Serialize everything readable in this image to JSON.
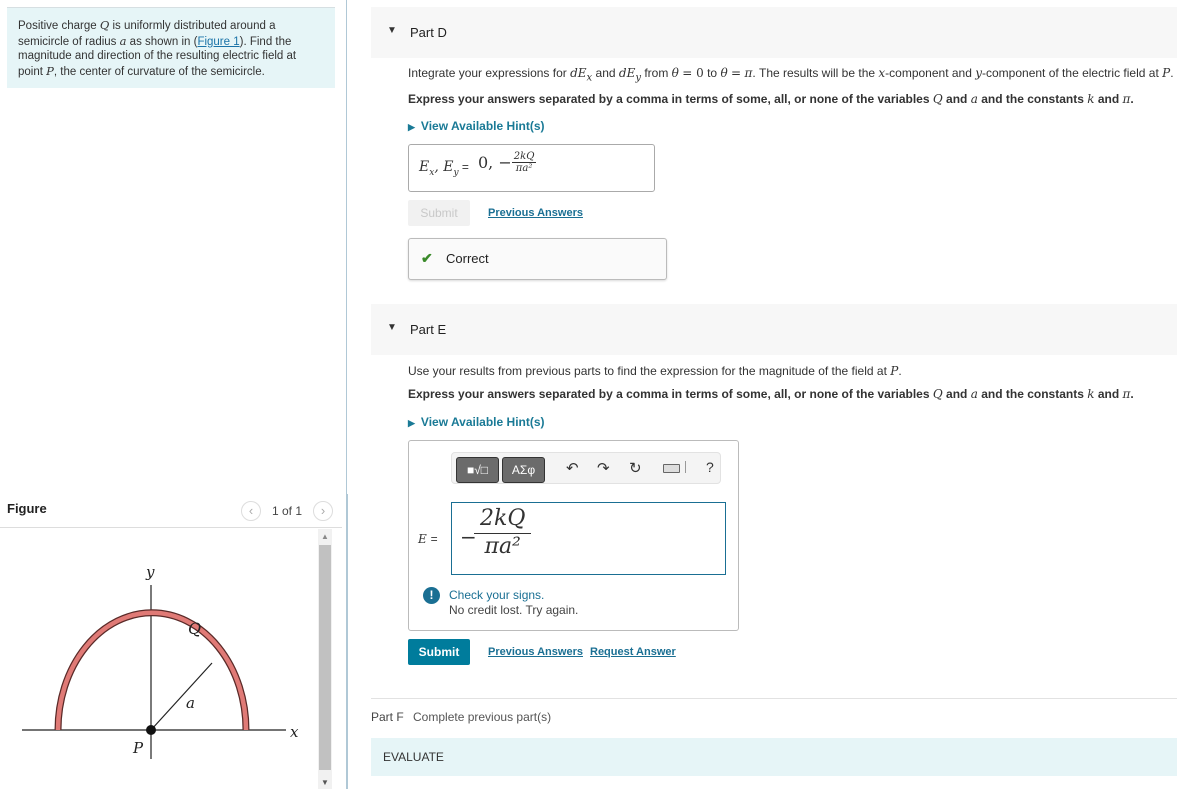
{
  "problem": {
    "text_before_Q": "Positive charge ",
    "var_Q": "Q",
    "text_after_Q": " is uniformly distributed around a semicircle of radius ",
    "var_a": "a",
    "text_before_link": " as shown in (",
    "figure_link": "Figure 1",
    "text_after_link": "). Find the magnitude and direction of the resulting electric field at point ",
    "var_P": "P",
    "text_end": ", the center of curvature of the semicircle."
  },
  "figure": {
    "title": "Figure",
    "page_count": "1 of 1",
    "prev_icon": "chevron-left-icon",
    "next_icon": "chevron-right-icon",
    "labels": {
      "y": "y",
      "x": "x",
      "Q": "Q",
      "a": "a",
      "P": "P"
    },
    "arc_color": "#e07a76"
  },
  "part_d": {
    "title": "Part D",
    "instruction_1": "Integrate your expressions for dEₓ and dE_y from θ = 0 to θ = π. The results will be the x-component and y-component of the electric field at P.",
    "instruction_2": "Express your answers separated by a comma in terms of some, all, or none of the variables Q and a and the constants k and π.",
    "hint": "View Available Hint(s)",
    "answer_label": "Eₓ, E_y =",
    "answer_value_prefix": "0, −",
    "answer_num": "2kQ",
    "answer_den": "πa²",
    "submit": "Submit",
    "previous_answers": "Previous Answers",
    "status": "Correct"
  },
  "part_e": {
    "title": "Part E",
    "instruction_1": "Use your results from previous parts to find the expression for the magnitude of the field at P.",
    "instruction_2": "Express your answers separated by a comma in terms of some, all, or none of the variables Q and a and the constants k and π.",
    "hint": "View Available Hint(s)",
    "toolbar": {
      "templates": "■√□",
      "greek": "ΑΣφ",
      "undo": "↶",
      "redo": "↷",
      "reset": "↻",
      "help": "?"
    },
    "answer_label": "E =",
    "answer_sign": "−",
    "answer_num": "2kQ",
    "answer_den": "πa²",
    "feedback_title": "Check your signs.",
    "feedback_detail": "No credit lost. Try again.",
    "submit": "Submit",
    "previous_answers": "Previous Answers",
    "request_answer": "Request Answer"
  },
  "part_f": {
    "title": "Part F",
    "status": "Complete previous part(s)"
  },
  "evaluate": "EVALUATE",
  "colors": {
    "accent": "#007c9c",
    "link": "#1a6f93",
    "problem_bg": "#e6f5f7",
    "correct": "#3a8a2a"
  }
}
